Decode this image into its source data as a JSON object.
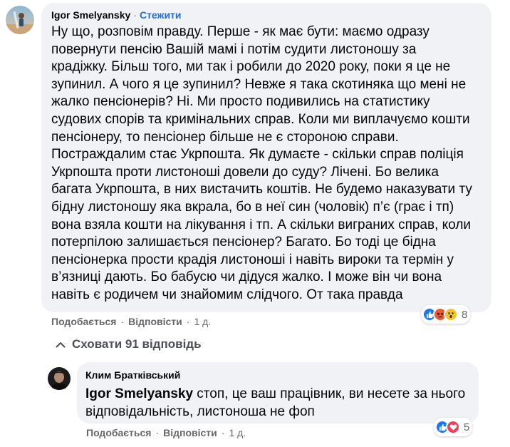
{
  "comment": {
    "author": "Igor Smelyansky",
    "separator": "·",
    "follow_label": "Стежити",
    "lines": [
      "Ну що, розповім правду. Перше - як має бути: маємо одразу",
      "повернути пенсію Вашій мамі і потім судити листоношу за",
      "крадіжку. Більш того, ми так і робили до 2020 року, поки я це не",
      "зупинил. А чого я це зупинил? Невже я така скотиняка що мені не",
      "жалко пенсіонерів? Ні. Ми просто подивились на статистику",
      "судових спорів та кримінальних справ. Коли ми виплачуємо кошти",
      "пенсіонеру, то пенсіонер більше не є стороною справи.",
      "Постраждалим стає Укрпошта. Як думаєте - скільки справ поліція",
      "Укрпошта проти листоноші довели до суду? Лічені. Бо велика",
      "багата Укрпошта, в них вистачить коштів. Не будемо наказувати ту",
      "бідну листоношу яка вкрала, бо в неї син (чоловік) п’є (грає і тп)",
      "вона взяла кошти на лікування і тп. А скільки виграних справ, коли",
      "потерпілою залишається пенсіонер? Багато. Бо тоді це бідна",
      "пенсіонерка прости крадія листоноші і навіть вироки та термін у",
      "в’язниці дають. Бо бабусю чи дідуся жалко. І може він чи вона",
      "навіть є родичем чи знайомим слідчого. От така правда"
    ],
    "actions": {
      "like_label": "Подобається",
      "reply_label": "Відповісти",
      "time": "1 д."
    },
    "reactions": {
      "icons": [
        "like-icon",
        "angry-icon",
        "wow-icon"
      ],
      "count": "8"
    }
  },
  "hide_replies_label": "Сховати 91 відповідь",
  "reply": {
    "author": "Клим Братківський",
    "mention": "Igor Smelyansky",
    "text_line1": " стоп, це ваш працівник, ви несете за нього",
    "text_line2": "відповідальність, листоноша не фоп",
    "actions": {
      "like_label": "Подобається",
      "reply_label": "Відповісти",
      "time": "1 д."
    },
    "reactions": {
      "icons": [
        "like-icon",
        "love-icon"
      ],
      "count": "5"
    }
  },
  "colors": {
    "bubble": "#f0f2f5",
    "follow_link": "#216fdb",
    "secondary_text": "#65676b",
    "like_reaction": "#1877f2",
    "angry_reaction": "#f0572f",
    "wow_reaction": "#f7c22a",
    "love_reaction": "#f33e58"
  }
}
